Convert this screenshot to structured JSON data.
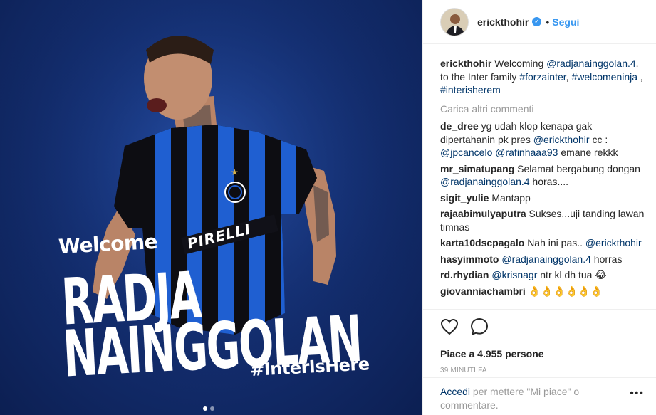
{
  "media": {
    "welcome": "Welcome",
    "first_name": "RADJA",
    "last_name": "NAINGGOLAN",
    "hashtag": "#InterIsHere",
    "sponsor": "PIRELLI",
    "carousel": {
      "count": 2,
      "active": 1
    },
    "colors": {
      "background": "#142f72",
      "stripe": "#1f5fd1",
      "shirt": "#0d0d12"
    }
  },
  "header": {
    "username": "erickthohir",
    "verified_icon": "verified-badge",
    "separator": "•",
    "follow_label": "Segui"
  },
  "caption": {
    "user": "erickthohir",
    "text1": "Welcoming ",
    "mention": "@radjanainggolan.4",
    "text2": ". to the Inter family ",
    "tag1": "#forzainter",
    "text3": ",",
    "tag2": "#welcomeninja",
    "text4": " , ",
    "tag3": "#interisherem"
  },
  "load_more": "Carica altri commenti",
  "comments": [
    {
      "user": "de_dree",
      "parts": [
        {
          "t": "yg udah klop kenapa gak dipertahanin pk pres ",
          "m": false
        },
        {
          "t": "@erickthohir",
          "m": true
        },
        {
          "t": " cc : ",
          "m": false
        },
        {
          "t": "@jpcancelo",
          "m": true
        },
        {
          "t": " ",
          "m": false
        },
        {
          "t": "@rafinhaaa93",
          "m": true
        },
        {
          "t": " emane rekkk",
          "m": false
        }
      ]
    },
    {
      "user": "mr_simatupang",
      "parts": [
        {
          "t": "Selamat bergabung dongan ",
          "m": false
        },
        {
          "t": "@radjanainggolan.4",
          "m": true
        },
        {
          "t": " horas....",
          "m": false
        }
      ]
    },
    {
      "user": "sigit_yulie",
      "parts": [
        {
          "t": "Mantapp",
          "m": false
        }
      ]
    },
    {
      "user": "rajaabimulyaputra",
      "parts": [
        {
          "t": "Sukses...uji tanding lawan timnas",
          "m": false
        }
      ]
    },
    {
      "user": "karta10dscpagalo",
      "parts": [
        {
          "t": "Nah ini pas.. ",
          "m": false
        },
        {
          "t": "@erickthohir",
          "m": true
        }
      ]
    },
    {
      "user": "hasyimmoto",
      "parts": [
        {
          "t": "@radjanainggolan.4",
          "m": true
        },
        {
          "t": " horras",
          "m": false
        }
      ]
    },
    {
      "user": "rd.rhydian",
      "parts": [
        {
          "t": "@krisnagr",
          "m": true
        },
        {
          "t": " ntr kl dh tua 😂",
          "m": false
        }
      ]
    },
    {
      "user": "giovanniachambri",
      "parts": [
        {
          "t": "👌👌👌👌👌👌",
          "m": false
        }
      ]
    }
  ],
  "actions": {
    "like_icon": "heart-icon",
    "comment_icon": "comment-icon",
    "likes_text": "Piace a 4.955 persone",
    "time_text": "39 MINUTI FA"
  },
  "login": {
    "link": "Accedi",
    "text": " per mettere \"Mi piace\" o commentare.",
    "more": "•••"
  }
}
